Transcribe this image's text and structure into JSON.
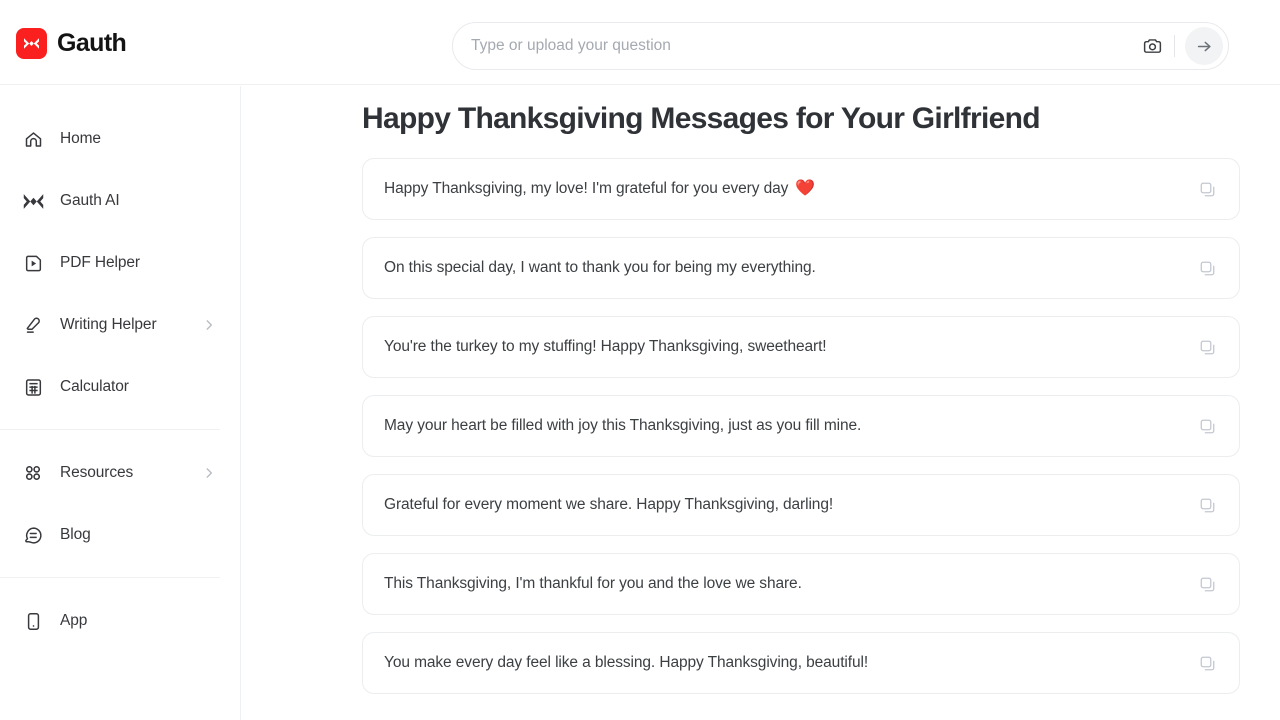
{
  "header": {
    "brand_name": "Gauth",
    "logo_icon": "gauth-logo-icon",
    "search": {
      "placeholder": "Type or upload your question",
      "value": "",
      "camera_icon": "camera-icon",
      "send_icon": "arrow-right-icon"
    }
  },
  "sidebar": {
    "groups": [
      {
        "items": [
          {
            "label": "Home",
            "icon": "home-icon",
            "chevron": false
          },
          {
            "label": "Gauth AI",
            "icon": "gauth-ai-icon",
            "chevron": false
          },
          {
            "label": "PDF Helper",
            "icon": "pdf-helper-icon",
            "chevron": false
          },
          {
            "label": "Writing Helper",
            "icon": "pencil-icon",
            "chevron": true
          },
          {
            "label": "Calculator",
            "icon": "calculator-icon",
            "chevron": false
          }
        ]
      },
      {
        "items": [
          {
            "label": "Resources",
            "icon": "grid-icon",
            "chevron": true
          },
          {
            "label": "Blog",
            "icon": "blog-icon",
            "chevron": false
          }
        ]
      },
      {
        "items": [
          {
            "label": "App",
            "icon": "mobile-app-icon",
            "chevron": false
          }
        ]
      }
    ]
  },
  "main": {
    "title": "Happy Thanksgiving Messages for Your Girlfriend",
    "copy_icon": "copy-icon",
    "messages": [
      {
        "text": "Happy Thanksgiving, my love! I'm grateful for you every day",
        "emoji": "❤️"
      },
      {
        "text": "On this special day, I want to thank you for being my everything.",
        "emoji": ""
      },
      {
        "text": "You're the turkey to my stuffing! Happy Thanksgiving, sweetheart!",
        "emoji": ""
      },
      {
        "text": "May your heart be filled with joy this Thanksgiving, just as you fill mine.",
        "emoji": ""
      },
      {
        "text": "Grateful for every moment we share. Happy Thanksgiving, darling!",
        "emoji": ""
      },
      {
        "text": "This Thanksgiving, I'm thankful for you and the love we share.",
        "emoji": ""
      },
      {
        "text": "You make every day feel like a blessing. Happy Thanksgiving, beautiful!",
        "emoji": ""
      }
    ]
  },
  "colors": {
    "brand_red": "#fa2020",
    "text_primary": "#2f3236",
    "text_body": "#3c4043",
    "border": "#ebedef",
    "placeholder": "#a5a9b0"
  }
}
